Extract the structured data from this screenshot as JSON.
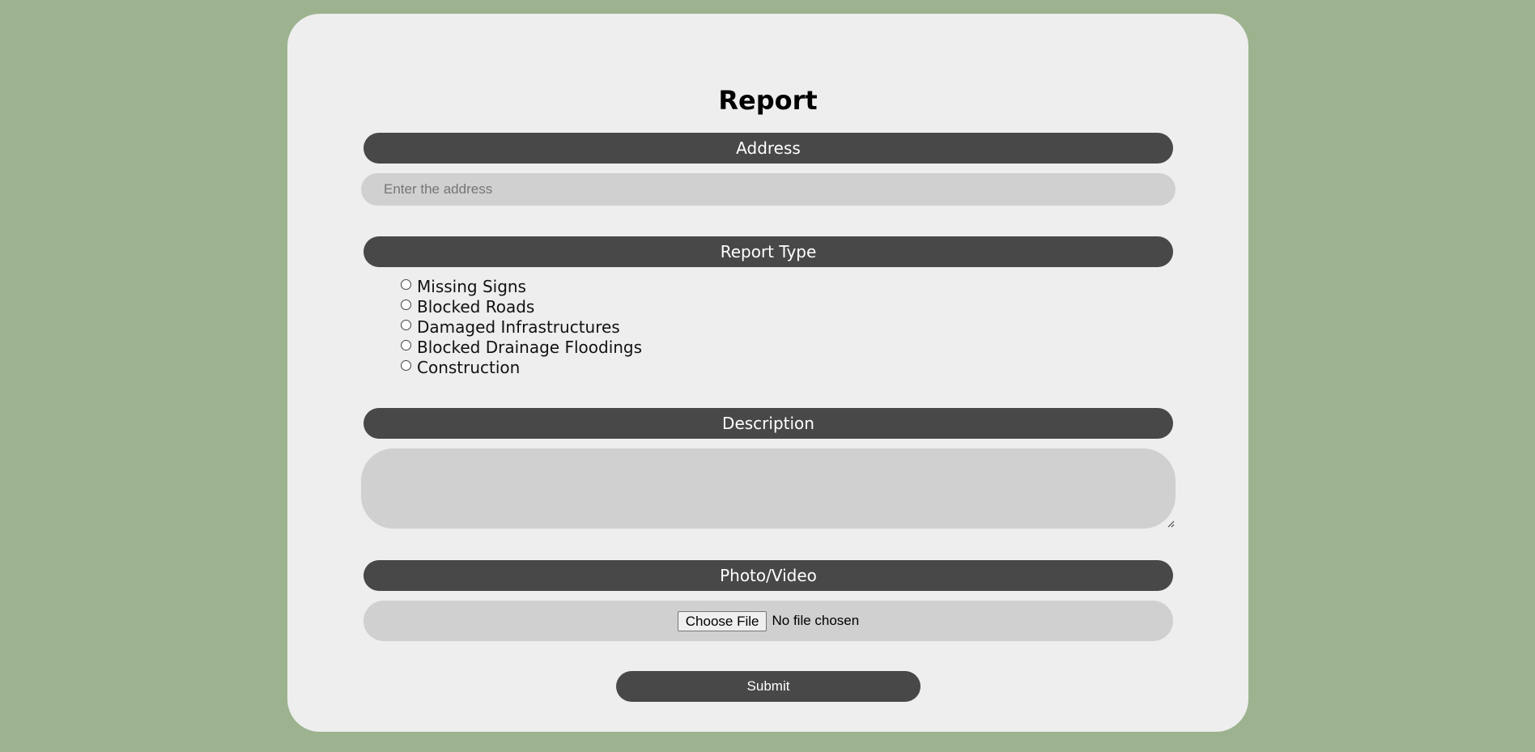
{
  "form": {
    "title": "Report",
    "address": {
      "label": "Address",
      "placeholder": "Enter the address",
      "value": ""
    },
    "report_type": {
      "label": "Report Type",
      "options": [
        {
          "label": "Missing Signs",
          "checked": false
        },
        {
          "label": "Blocked Roads",
          "checked": false
        },
        {
          "label": "Damaged Infrastructures",
          "checked": false
        },
        {
          "label": "Blocked Drainage Floodings",
          "checked": false
        },
        {
          "label": "Construction",
          "checked": false
        }
      ]
    },
    "description": {
      "label": "Description",
      "value": ""
    },
    "media": {
      "label": "Photo/Video",
      "button_label": "Choose File",
      "status": "No file chosen"
    },
    "submit_label": "Submit"
  },
  "colors": {
    "background": "#9db38f",
    "card": "#eeeeee",
    "label_bar": "#484848",
    "field": "#d0d0d0"
  }
}
